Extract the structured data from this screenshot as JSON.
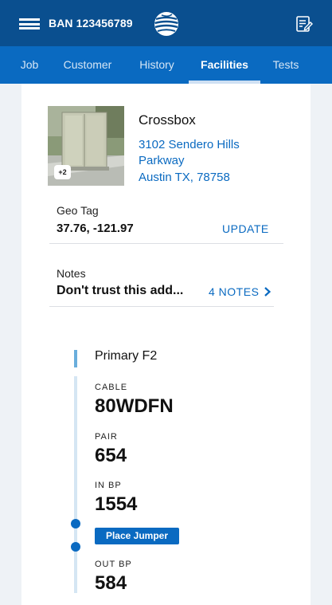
{
  "header": {
    "ban": "BAN 123456789",
    "menu_icon": "hamburger-menu-icon",
    "logo_icon": "att-globe-logo",
    "notes_icon": "notes-edit-icon"
  },
  "tabs": [
    {
      "label": "Job",
      "active": false
    },
    {
      "label": "Customer",
      "active": false
    },
    {
      "label": "History",
      "active": false
    },
    {
      "label": "Facilities",
      "active": true
    },
    {
      "label": "Tests",
      "active": false
    }
  ],
  "site": {
    "name": "Crossbox",
    "address_line1": "3102 Sendero Hills",
    "address_line2": "Parkway",
    "address_line3": "Austin TX, 78758",
    "photo_badge": "+2"
  },
  "geo": {
    "label": "Geo Tag",
    "value": "37.76, -121.97",
    "action": "UPDATE"
  },
  "notes": {
    "label": "Notes",
    "value": "Don't trust this add...",
    "action": "4 NOTES",
    "action_icon": "chevron-right-icon"
  },
  "facility": {
    "title": "Primary F2",
    "fields": [
      {
        "label": "CABLE",
        "value": "80WDFN"
      },
      {
        "label": "PAIR",
        "value": "654"
      },
      {
        "label": "IN BP",
        "value": "1554"
      },
      {
        "label": "OUT BP",
        "value": "584"
      }
    ],
    "jumper_button": "Place Jumper"
  },
  "colors": {
    "header_bg": "#0a4f8f",
    "tabs_bg": "#0a6ac1",
    "accent": "#0a6ac1",
    "page_bg": "#eef2f6"
  }
}
